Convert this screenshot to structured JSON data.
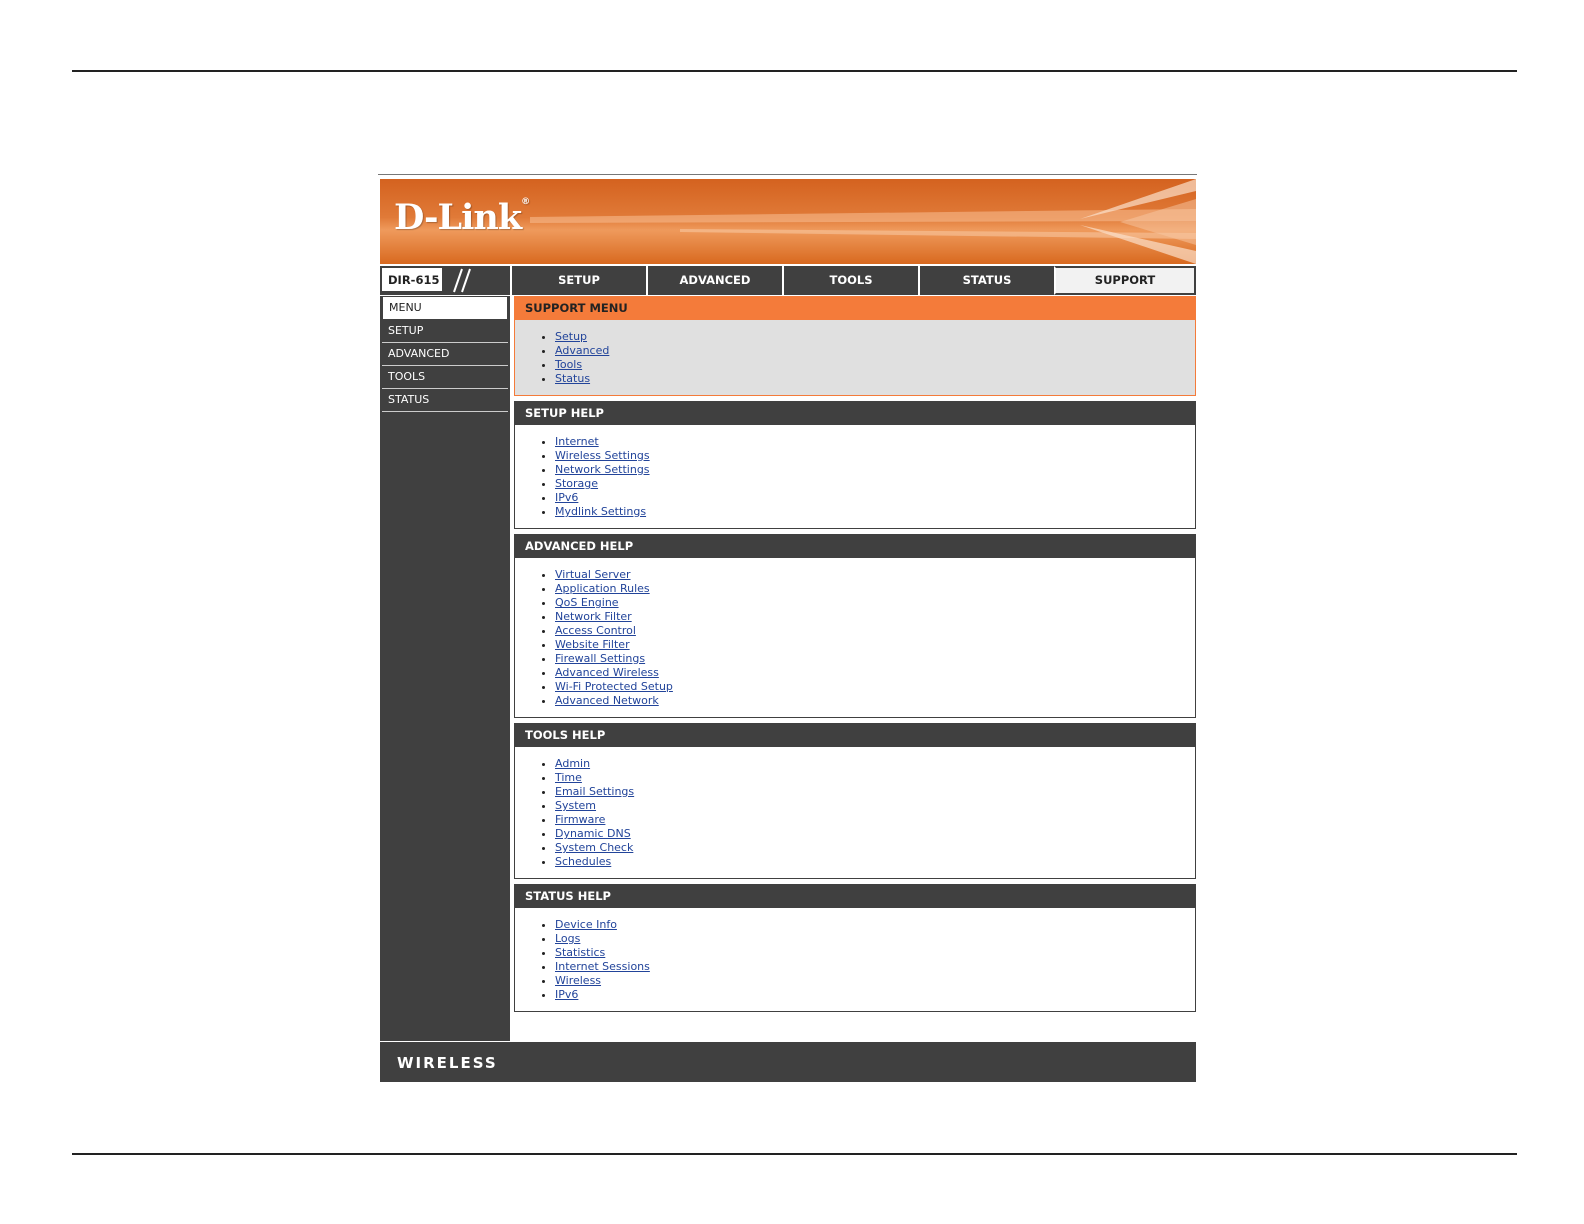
{
  "brand": {
    "logo_text": "D-Link",
    "registered_mark": "®"
  },
  "model": "DIR-615",
  "tabs": [
    {
      "label": "SETUP",
      "active": false
    },
    {
      "label": "ADVANCED",
      "active": false
    },
    {
      "label": "TOOLS",
      "active": false
    },
    {
      "label": "STATUS",
      "active": false
    },
    {
      "label": "SUPPORT",
      "active": true
    }
  ],
  "sidebar": {
    "items": [
      {
        "label": "MENU",
        "active": true
      },
      {
        "label": "SETUP",
        "active": false
      },
      {
        "label": "ADVANCED",
        "active": false
      },
      {
        "label": "TOOLS",
        "active": false
      },
      {
        "label": "STATUS",
        "active": false
      }
    ]
  },
  "sections": [
    {
      "title": "SUPPORT MENU",
      "style": "orange",
      "links": [
        "Setup",
        "Advanced",
        "Tools",
        "Status"
      ]
    },
    {
      "title": "SETUP HELP",
      "style": "dark",
      "links": [
        "Internet",
        "Wireless Settings",
        "Network Settings",
        "Storage",
        "IPv6",
        "Mydlink Settings"
      ]
    },
    {
      "title": "ADVANCED HELP",
      "style": "dark",
      "links": [
        "Virtual Server",
        "Application Rules",
        "QoS Engine",
        "Network Filter",
        "Access Control",
        "Website Filter",
        "Firewall Settings",
        "Advanced Wireless",
        "Wi-Fi Protected Setup",
        "Advanced Network"
      ]
    },
    {
      "title": "TOOLS HELP",
      "style": "dark",
      "links": [
        "Admin",
        "Time",
        "Email Settings",
        "System",
        "Firmware",
        "Dynamic DNS",
        "System Check",
        "Schedules"
      ]
    },
    {
      "title": "STATUS HELP",
      "style": "dark",
      "links": [
        "Device Info",
        "Logs",
        "Statistics",
        "Internet Sessions",
        "Wireless",
        "IPv6"
      ]
    }
  ],
  "footer": {
    "text": "WIRELESS"
  },
  "colors": {
    "accent": "#f47b3a",
    "dark": "#404040",
    "link": "#22449a",
    "banner": "#d4621f"
  }
}
